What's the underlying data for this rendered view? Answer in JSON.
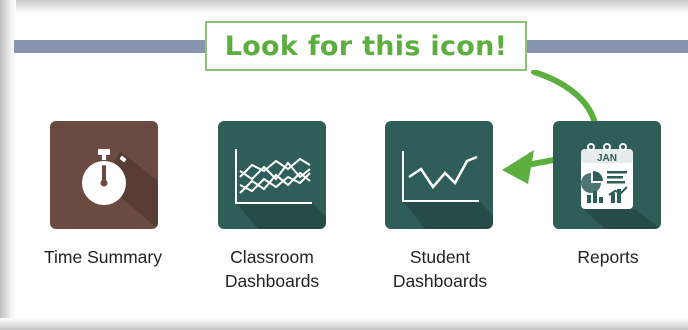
{
  "callout": {
    "text": "Look for this icon!"
  },
  "tiles": [
    {
      "label": "Time Summary",
      "icon": "stopwatch-icon"
    },
    {
      "label": "Classroom\nDashboards",
      "icon": "multi-line-chart-icon"
    },
    {
      "label": "Student\nDashboards",
      "icon": "line-chart-icon"
    },
    {
      "label": "Reports",
      "icon": "calendar-report-icon",
      "icon_text": "JAN"
    }
  ],
  "colors": {
    "header_bar": "#8796ae",
    "callout_green": "#5cae3e",
    "tile_teal": "#2f5d5a",
    "tile_brown": "#6b4b41"
  }
}
